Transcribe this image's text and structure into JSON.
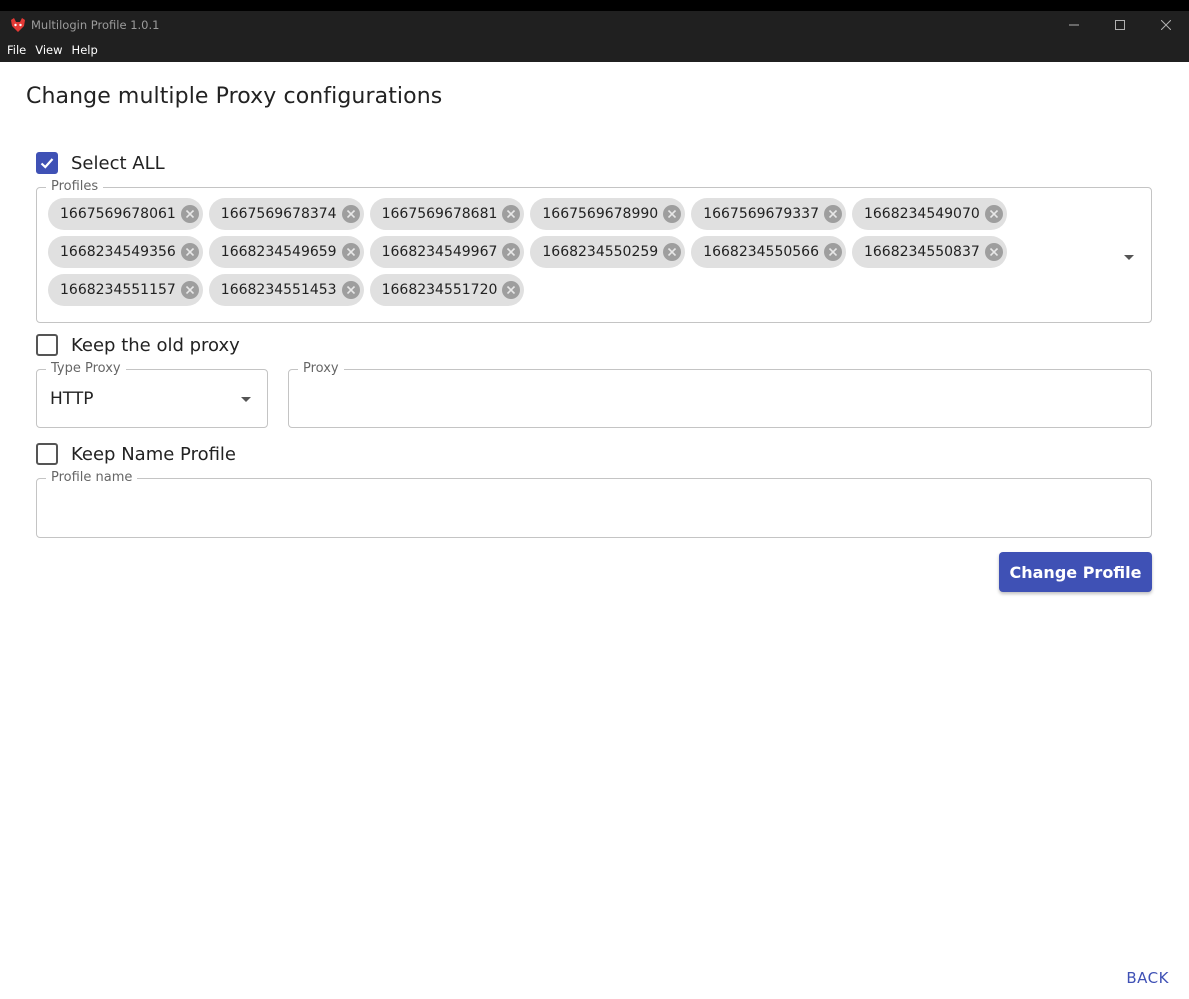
{
  "window": {
    "title": "Multilogin Profile 1.0.1",
    "controls": [
      "minimize",
      "maximize",
      "close"
    ]
  },
  "menu": [
    "File",
    "View",
    "Help"
  ],
  "page": {
    "title": "Change multiple Proxy configurations"
  },
  "select_all": {
    "label": "Select ALL",
    "checked": true
  },
  "profiles": {
    "legend": "Profiles",
    "rows": [
      [
        "1667569678061",
        "1667569678374",
        "1667569678681",
        "1667569678990",
        "1667569679337",
        "1668234549070"
      ],
      [
        "1668234549356",
        "1668234549659",
        "1668234549967",
        "1668234550259",
        "1668234550566",
        "1668234550837"
      ],
      [
        "1668234551157",
        "1668234551453",
        "1668234551720"
      ]
    ]
  },
  "keep_old_proxy": {
    "label": "Keep the old proxy",
    "checked": false
  },
  "type_proxy": {
    "legend": "Type Proxy",
    "value": "HTTP"
  },
  "proxy": {
    "legend": "Proxy",
    "value": ""
  },
  "keep_name": {
    "label": "Keep Name Profile",
    "checked": false
  },
  "profile_name": {
    "legend": "Profile name",
    "value": ""
  },
  "actions": {
    "change_label": "Change Profile",
    "back_label": "BACK"
  },
  "colors": {
    "primary": "#3f51b5",
    "titlebar": "#202020",
    "chip": "#e0e0e0"
  }
}
